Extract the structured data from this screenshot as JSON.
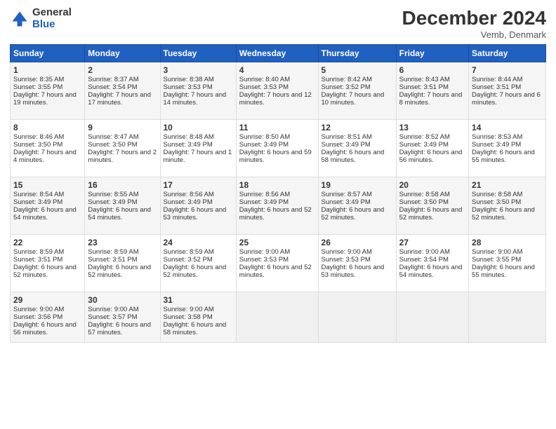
{
  "logo": {
    "general": "General",
    "blue": "Blue"
  },
  "title": "December 2024",
  "location": "Vemb, Denmark",
  "days_header": [
    "Sunday",
    "Monday",
    "Tuesday",
    "Wednesday",
    "Thursday",
    "Friday",
    "Saturday"
  ],
  "weeks": [
    [
      {
        "day": "1",
        "rise": "Sunrise: 8:35 AM",
        "set": "Sunset: 3:55 PM",
        "daylight": "Daylight: 7 hours and 19 minutes."
      },
      {
        "day": "2",
        "rise": "Sunrise: 8:37 AM",
        "set": "Sunset: 3:54 PM",
        "daylight": "Daylight: 7 hours and 17 minutes."
      },
      {
        "day": "3",
        "rise": "Sunrise: 8:38 AM",
        "set": "Sunset: 3:53 PM",
        "daylight": "Daylight: 7 hours and 14 minutes."
      },
      {
        "day": "4",
        "rise": "Sunrise: 8:40 AM",
        "set": "Sunset: 3:53 PM",
        "daylight": "Daylight: 7 hours and 12 minutes."
      },
      {
        "day": "5",
        "rise": "Sunrise: 8:42 AM",
        "set": "Sunset: 3:52 PM",
        "daylight": "Daylight: 7 hours and 10 minutes."
      },
      {
        "day": "6",
        "rise": "Sunrise: 8:43 AM",
        "set": "Sunset: 3:51 PM",
        "daylight": "Daylight: 7 hours and 8 minutes."
      },
      {
        "day": "7",
        "rise": "Sunrise: 8:44 AM",
        "set": "Sunset: 3:51 PM",
        "daylight": "Daylight: 7 hours and 6 minutes."
      }
    ],
    [
      {
        "day": "8",
        "rise": "Sunrise: 8:46 AM",
        "set": "Sunset: 3:50 PM",
        "daylight": "Daylight: 7 hours and 4 minutes."
      },
      {
        "day": "9",
        "rise": "Sunrise: 8:47 AM",
        "set": "Sunset: 3:50 PM",
        "daylight": "Daylight: 7 hours and 2 minutes."
      },
      {
        "day": "10",
        "rise": "Sunrise: 8:48 AM",
        "set": "Sunset: 3:49 PM",
        "daylight": "Daylight: 7 hours and 1 minute."
      },
      {
        "day": "11",
        "rise": "Sunrise: 8:50 AM",
        "set": "Sunset: 3:49 PM",
        "daylight": "Daylight: 6 hours and 59 minutes."
      },
      {
        "day": "12",
        "rise": "Sunrise: 8:51 AM",
        "set": "Sunset: 3:49 PM",
        "daylight": "Daylight: 6 hours and 58 minutes."
      },
      {
        "day": "13",
        "rise": "Sunrise: 8:52 AM",
        "set": "Sunset: 3:49 PM",
        "daylight": "Daylight: 6 hours and 56 minutes."
      },
      {
        "day": "14",
        "rise": "Sunrise: 8:53 AM",
        "set": "Sunset: 3:49 PM",
        "daylight": "Daylight: 6 hours and 55 minutes."
      }
    ],
    [
      {
        "day": "15",
        "rise": "Sunrise: 8:54 AM",
        "set": "Sunset: 3:49 PM",
        "daylight": "Daylight: 6 hours and 54 minutes."
      },
      {
        "day": "16",
        "rise": "Sunrise: 8:55 AM",
        "set": "Sunset: 3:49 PM",
        "daylight": "Daylight: 6 hours and 54 minutes."
      },
      {
        "day": "17",
        "rise": "Sunrise: 8:56 AM",
        "set": "Sunset: 3:49 PM",
        "daylight": "Daylight: 6 hours and 53 minutes."
      },
      {
        "day": "18",
        "rise": "Sunrise: 8:56 AM",
        "set": "Sunset: 3:49 PM",
        "daylight": "Daylight: 6 hours and 52 minutes."
      },
      {
        "day": "19",
        "rise": "Sunrise: 8:57 AM",
        "set": "Sunset: 3:49 PM",
        "daylight": "Daylight: 6 hours and 52 minutes."
      },
      {
        "day": "20",
        "rise": "Sunrise: 8:58 AM",
        "set": "Sunset: 3:50 PM",
        "daylight": "Daylight: 6 hours and 52 minutes."
      },
      {
        "day": "21",
        "rise": "Sunrise: 8:58 AM",
        "set": "Sunset: 3:50 PM",
        "daylight": "Daylight: 6 hours and 52 minutes."
      }
    ],
    [
      {
        "day": "22",
        "rise": "Sunrise: 8:59 AM",
        "set": "Sunset: 3:51 PM",
        "daylight": "Daylight: 6 hours and 52 minutes."
      },
      {
        "day": "23",
        "rise": "Sunrise: 8:59 AM",
        "set": "Sunset: 3:51 PM",
        "daylight": "Daylight: 6 hours and 52 minutes."
      },
      {
        "day": "24",
        "rise": "Sunrise: 8:59 AM",
        "set": "Sunset: 3:52 PM",
        "daylight": "Daylight: 6 hours and 52 minutes."
      },
      {
        "day": "25",
        "rise": "Sunrise: 9:00 AM",
        "set": "Sunset: 3:53 PM",
        "daylight": "Daylight: 6 hours and 52 minutes."
      },
      {
        "day": "26",
        "rise": "Sunrise: 9:00 AM",
        "set": "Sunset: 3:53 PM",
        "daylight": "Daylight: 6 hours and 53 minutes."
      },
      {
        "day": "27",
        "rise": "Sunrise: 9:00 AM",
        "set": "Sunset: 3:54 PM",
        "daylight": "Daylight: 6 hours and 54 minutes."
      },
      {
        "day": "28",
        "rise": "Sunrise: 9:00 AM",
        "set": "Sunset: 3:55 PM",
        "daylight": "Daylight: 6 hours and 55 minutes."
      }
    ],
    [
      {
        "day": "29",
        "rise": "Sunrise: 9:00 AM",
        "set": "Sunset: 3:56 PM",
        "daylight": "Daylight: 6 hours and 56 minutes."
      },
      {
        "day": "30",
        "rise": "Sunrise: 9:00 AM",
        "set": "Sunset: 3:57 PM",
        "daylight": "Daylight: 6 hours and 57 minutes."
      },
      {
        "day": "31",
        "rise": "Sunrise: 9:00 AM",
        "set": "Sunset: 3:58 PM",
        "daylight": "Daylight: 6 hours and 58 minutes."
      },
      null,
      null,
      null,
      null
    ]
  ]
}
